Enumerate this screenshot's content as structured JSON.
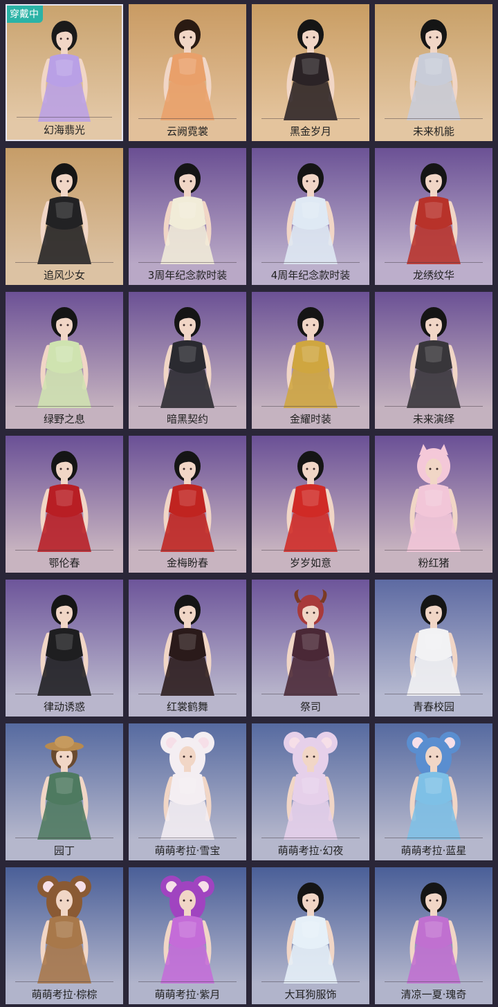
{
  "badge_label": "穿戴中",
  "outfits": [
    {
      "name": "幻海翡光",
      "bg": [
        "#c9a36e",
        "#e3c8a7"
      ],
      "outfit": "#b9a0e6",
      "hair": "#1a1a1a",
      "hat": "none",
      "selected": true
    },
    {
      "name": "云阙霓裳",
      "bg": [
        "#c99b63",
        "#e2c09a"
      ],
      "outfit": "#e9a06a",
      "hair": "#2a1a12",
      "hat": "none",
      "selected": false
    },
    {
      "name": "黑金岁月",
      "bg": [
        "#c99d63",
        "#e4c49d"
      ],
      "outfit": "#2b2326",
      "hair": "#151515",
      "hat": "none",
      "selected": false
    },
    {
      "name": "未来机能",
      "bg": [
        "#c8a068",
        "#e3c6a2"
      ],
      "outfit": "#c8ccd8",
      "hair": "#151515",
      "hat": "none",
      "selected": false
    },
    {
      "name": "追风少女",
      "bg": [
        "#c69d68",
        "#dcc2a3"
      ],
      "outfit": "#222224",
      "hair": "#151515",
      "hat": "none",
      "selected": false
    },
    {
      "name": "3周年纪念款时装",
      "bg": [
        "#6a4f93",
        "#b9a8c6"
      ],
      "outfit": "#f1ecd8",
      "hair": "#151515",
      "hat": "none",
      "selected": false
    },
    {
      "name": "4周年纪念款时装",
      "bg": [
        "#6c5396",
        "#bcb0cc"
      ],
      "outfit": "#dfe9f4",
      "hair": "#151515",
      "hat": "none",
      "selected": false
    },
    {
      "name": "龙绣纹华",
      "bg": [
        "#6b5195",
        "#bcaecb"
      ],
      "outfit": "#b8322a",
      "hair": "#151515",
      "hat": "none",
      "selected": false
    },
    {
      "name": "绿野之息",
      "bg": [
        "#6c5196",
        "#c5b2bf"
      ],
      "outfit": "#cfe3b0",
      "hair": "#151515",
      "hat": "none",
      "selected": false
    },
    {
      "name": "暗黑契约",
      "bg": [
        "#6b5195",
        "#c4b2c0"
      ],
      "outfit": "#2a2a30",
      "hair": "#151515",
      "hat": "none",
      "selected": false
    },
    {
      "name": "金耀时装",
      "bg": [
        "#6b5195",
        "#c5b3c0"
      ],
      "outfit": "#cfa640",
      "hair": "#151515",
      "hat": "none",
      "selected": false
    },
    {
      "name": "未来演绎",
      "bg": [
        "#6b5195",
        "#c4b2bf"
      ],
      "outfit": "#38363a",
      "hair": "#151515",
      "hat": "none",
      "selected": false
    },
    {
      "name": "鄂伦春",
      "bg": [
        "#6a5096",
        "#c8b4c0"
      ],
      "outfit": "#b81e24",
      "hair": "#151515",
      "hat": "none",
      "selected": false
    },
    {
      "name": "金梅盼春",
      "bg": [
        "#6a5096",
        "#c8b4c0"
      ],
      "outfit": "#c02420",
      "hair": "#151515",
      "hat": "none",
      "selected": false
    },
    {
      "name": "岁岁如意",
      "bg": [
        "#6a5096",
        "#c8b4c0"
      ],
      "outfit": "#d02a26",
      "hair": "#151515",
      "hat": "none",
      "selected": false
    },
    {
      "name": "粉红猪",
      "bg": [
        "#6a5096",
        "#c8b4c0"
      ],
      "outfit": "#f2c6d8",
      "hair": "#e8c0b8",
      "hat": "pig",
      "selected": false
    },
    {
      "name": "律动诱惑",
      "bg": [
        "#6d559a",
        "#b9b6cc"
      ],
      "outfit": "#1e1e20",
      "hair": "#151515",
      "hat": "none",
      "selected": false
    },
    {
      "name": "红裳鹤舞",
      "bg": [
        "#6d559a",
        "#b9b6cc"
      ],
      "outfit": "#2a1a1a",
      "hair": "#151515",
      "hat": "none",
      "selected": false
    },
    {
      "name": "祭司",
      "bg": [
        "#6d559a",
        "#b9b6cc"
      ],
      "outfit": "#4a2836",
      "hair": "#a83a3a",
      "hat": "horns",
      "selected": false
    },
    {
      "name": "青春校园",
      "bg": [
        "#5d6aa2",
        "#b6b9d0"
      ],
      "outfit": "#f2f2f4",
      "hair": "#151515",
      "hat": "none",
      "selected": false
    },
    {
      "name": "园丁",
      "bg": [
        "#566aa0",
        "#b5b7cc"
      ],
      "outfit": "#4e7a60",
      "hair": "#6a4a30",
      "hat": "straw",
      "selected": false
    },
    {
      "name": "萌萌考拉·雪宝",
      "bg": [
        "#566aa0",
        "#b5b7cc"
      ],
      "outfit": "#f4eef2",
      "hair": "#f4eef2",
      "hat": "koala-white",
      "selected": false
    },
    {
      "name": "萌萌考拉·幻夜",
      "bg": [
        "#566aa0",
        "#b5b7cc"
      ],
      "outfit": "#e6d0ea",
      "hair": "#e6d0ea",
      "hat": "koala-rainbow",
      "selected": false
    },
    {
      "name": "萌萌考拉·蓝星",
      "bg": [
        "#566aa0",
        "#b5b7cc"
      ],
      "outfit": "#7ec0e6",
      "hair": "#5a8ed0",
      "hat": "koala-blue",
      "selected": false
    },
    {
      "name": "萌萌考拉·棕棕",
      "bg": [
        "#4a5f98",
        "#b1b4cb"
      ],
      "outfit": "#a8784a",
      "hair": "#8a5a34",
      "hat": "koala-brown",
      "selected": false
    },
    {
      "name": "萌萌考拉·紫月",
      "bg": [
        "#4a5f98",
        "#b1b4cb"
      ],
      "outfit": "#c46cd8",
      "hair": "#a044c0",
      "hat": "koala-purple",
      "selected": false
    },
    {
      "name": "大耳狗服饰",
      "bg": [
        "#4a5f98",
        "#b1b4cb"
      ],
      "outfit": "#e6f0f8",
      "hair": "#151515",
      "hat": "none",
      "selected": false
    },
    {
      "name": "清凉一夏·瑰奇",
      "bg": [
        "#4a5f98",
        "#b1b4cb"
      ],
      "outfit": "#c070d0",
      "hair": "#151515",
      "hat": "none",
      "selected": false
    }
  ]
}
